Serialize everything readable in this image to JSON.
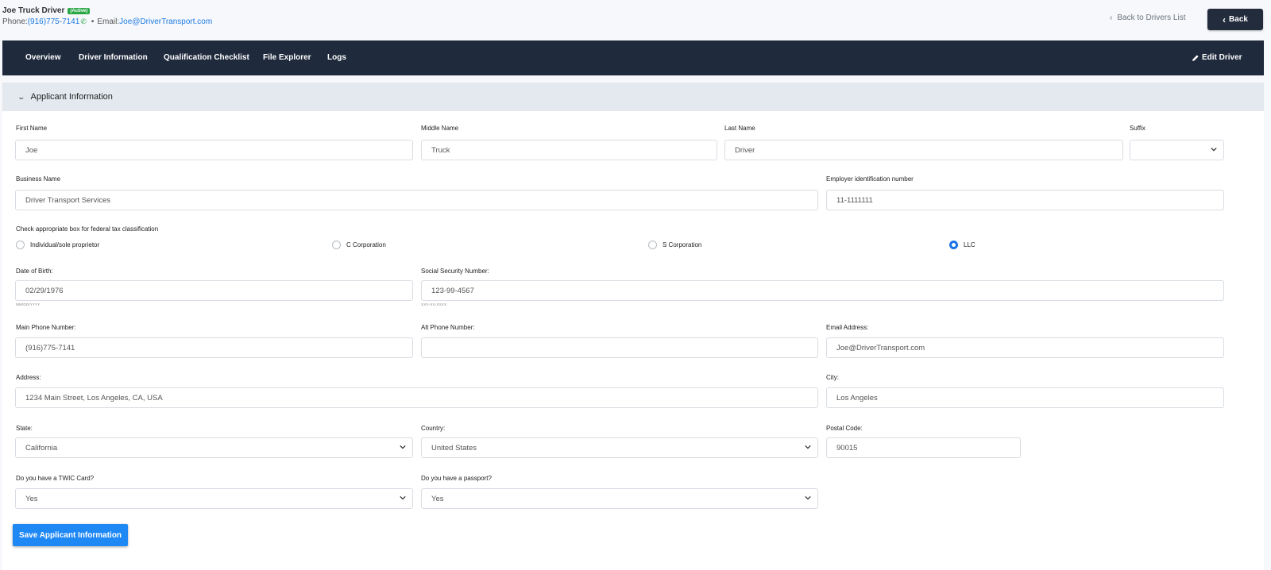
{
  "header": {
    "driver_name": "Joe Truck Driver",
    "status": "(Active)",
    "phone_label": "Phone:",
    "phone": "(916)775-7141",
    "bullet": "•",
    "email_label": "Email:",
    "email": "Joe@DriverTransport.com",
    "back_link": "Back to Drivers List",
    "back_button": "Back"
  },
  "nav": {
    "items": [
      "Overview",
      "Driver Information",
      "Qualification Checklist",
      "File Explorer",
      "Logs"
    ],
    "edit": "Edit Driver"
  },
  "panel": {
    "title": "Applicant Information"
  },
  "form": {
    "first_name": {
      "label": "First Name",
      "value": "Joe"
    },
    "middle_name": {
      "label": "Middle Name",
      "value": "Truck"
    },
    "last_name": {
      "label": "Last Name",
      "value": "Driver"
    },
    "suffix": {
      "label": "Suffix",
      "value": ""
    },
    "business_name": {
      "label": "Business Name",
      "value": "Driver Transport Services"
    },
    "ein": {
      "label": "Employer identification number",
      "value": "11-1111111"
    },
    "tax_classification": {
      "label": "Check appropriate box for federal tax classification",
      "options": [
        "Individual/sole proprietor",
        "C Corporation",
        "S Corporation",
        "LLC"
      ],
      "selected": "LLC"
    },
    "dob": {
      "label": "Date of Birth:",
      "value": "02/29/1976",
      "hint": "MM/DD/YYYY"
    },
    "ssn": {
      "label": "Social Security Number:",
      "value": "123-99-4567",
      "hint": "XXX-XX-XXXX"
    },
    "main_phone": {
      "label": "Main Phone Number:",
      "value": "(916)775-7141"
    },
    "alt_phone": {
      "label": "Alt Phone Number:",
      "value": ""
    },
    "email": {
      "label": "Email Address:",
      "value": "Joe@DriverTransport.com"
    },
    "address": {
      "label": "Address:",
      "value": "1234 Main Street, Los Angeles, CA, USA"
    },
    "city": {
      "label": "City:",
      "value": "Los Angeles"
    },
    "state": {
      "label": "State:",
      "value": "California"
    },
    "country": {
      "label": "Country:",
      "value": "United States"
    },
    "postal": {
      "label": "Postal Code:",
      "value": "90015"
    },
    "twic": {
      "label": "Do you have a TWIC Card?",
      "value": "Yes"
    },
    "passport": {
      "label": "Do you have a passport?",
      "value": "Yes"
    },
    "save_button": "Save Applicant Information"
  },
  "colors": {
    "nav_bg": "#1f2a3d",
    "accent": "#1e88f5",
    "active_badge": "#28a745",
    "link": "#1e7be3"
  }
}
